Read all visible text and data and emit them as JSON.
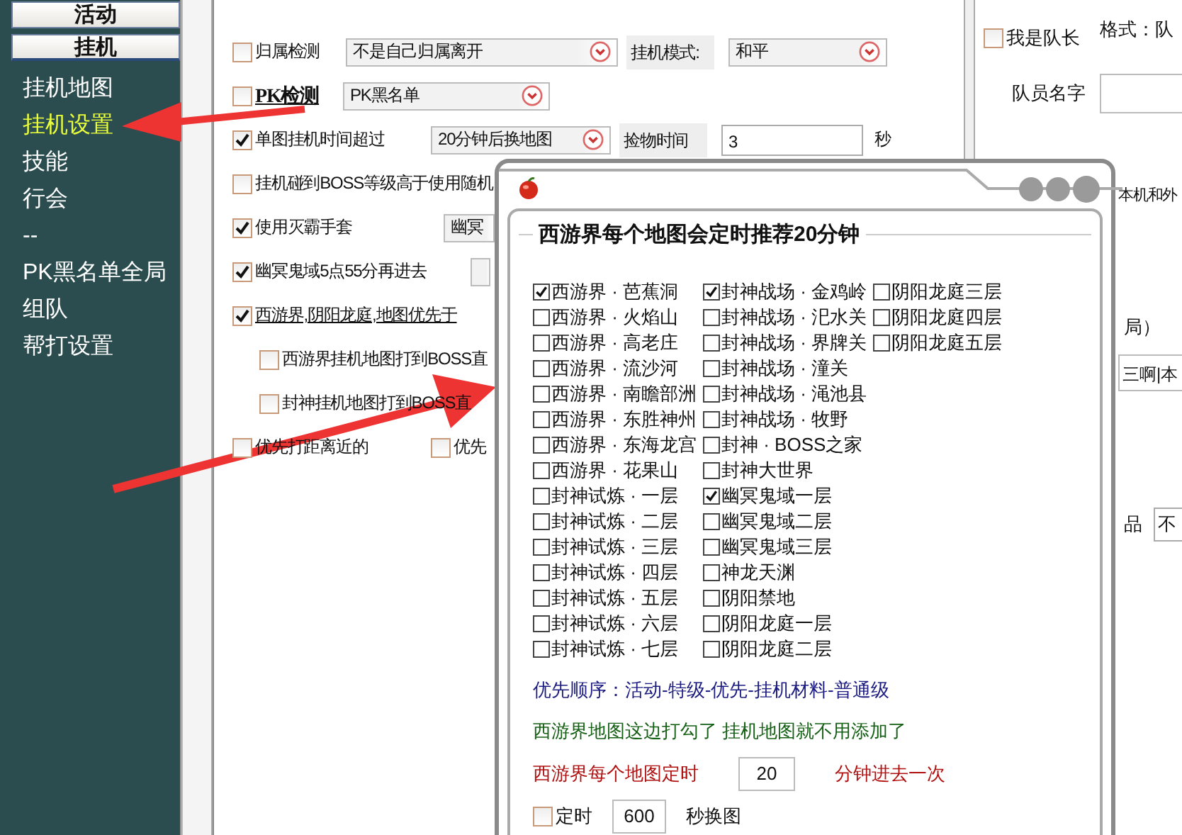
{
  "sidebar": {
    "tabs": [
      {
        "label": "活动",
        "selected": false
      },
      {
        "label": "挂机",
        "selected": true
      }
    ],
    "items": [
      {
        "label": "挂机地图",
        "selected": false
      },
      {
        "label": "挂机设置",
        "selected": true
      },
      {
        "label": "技能",
        "selected": false
      },
      {
        "label": "行会",
        "selected": false
      },
      {
        "label": "--",
        "selected": false
      },
      {
        "label": "PK黑名单全局",
        "selected": false
      },
      {
        "label": "组队",
        "selected": false
      },
      {
        "label": "帮打设置",
        "selected": false
      }
    ]
  },
  "settings": {
    "rows": [
      {
        "items": [
          {
            "kind": "checkbox",
            "label": "归属检测",
            "checked": false
          },
          {
            "kind": "select",
            "value": "不是自己归属离开"
          },
          {
            "kind": "label",
            "text": "挂机模式:"
          },
          {
            "kind": "select",
            "value": "和平"
          }
        ]
      },
      {
        "items": [
          {
            "kind": "link_checkbox",
            "label": "PK检测",
            "checked": false
          },
          {
            "kind": "select",
            "value": "PK黑名单"
          }
        ]
      },
      {
        "items": [
          {
            "kind": "checkbox",
            "label": "单图挂机时间超过",
            "checked": true
          },
          {
            "kind": "select",
            "value": "20分钟后换地图"
          },
          {
            "kind": "label",
            "text": "捡物时间"
          },
          {
            "kind": "input",
            "value": "3"
          },
          {
            "kind": "text",
            "text": "秒"
          }
        ]
      },
      {
        "items": [
          {
            "kind": "checkbox",
            "label": "挂机碰到BOSS等级高于使用随机",
            "checked": false
          }
        ]
      },
      {
        "items": [
          {
            "kind": "checkbox",
            "label": "使用灭霸手套",
            "checked": true
          },
          {
            "kind": "select_cut",
            "value": "幽冥"
          }
        ]
      },
      {
        "items": [
          {
            "kind": "checkbox",
            "label": "幽冥鬼域5点55分再进去",
            "checked": true
          },
          {
            "kind": "select_edge"
          }
        ]
      },
      {
        "items": [
          {
            "kind": "underlined_checkbox",
            "label": "西游界,阴阳龙庭,地图优先于",
            "checked": true
          }
        ]
      },
      {
        "items": [
          {
            "kind": "sub_checkbox",
            "label": "西游界挂机地图打到BOSS直",
            "checked": false
          }
        ]
      },
      {
        "items": [
          {
            "kind": "sub_checkbox",
            "label": "封神挂机地图打到BOSS直",
            "checked": false
          }
        ]
      },
      {
        "items": [
          {
            "kind": "checkbox",
            "label": "优先打距离近的",
            "checked": false
          },
          {
            "kind": "checkbox",
            "label": "优先",
            "checked": false
          }
        ]
      }
    ]
  },
  "team": {
    "format_hint": "格式：队",
    "leader": {
      "label": "我是队长",
      "checked": false
    },
    "member_name_label": "队员名字",
    "fragment_1": "本机和外",
    "fragment_2": "局）",
    "names_field": "三啊|本",
    "fragment_3": "品",
    "drop_value": "不"
  },
  "dialog": {
    "group_title": "西游界每个地图会定时推荐20分钟",
    "columns": [
      {
        "items": [
          {
            "label": "西游界 · 芭蕉洞",
            "checked": true
          },
          {
            "label": "西游界 · 火焰山",
            "checked": false
          },
          {
            "label": "西游界 · 高老庄",
            "checked": false
          },
          {
            "label": "西游界 · 流沙河",
            "checked": false
          },
          {
            "label": "西游界 · 南瞻部洲",
            "checked": false
          },
          {
            "label": "西游界 · 东胜神州",
            "checked": false
          },
          {
            "label": "西游界 · 东海龙宫",
            "checked": false
          },
          {
            "label": "西游界 · 花果山",
            "checked": false
          },
          {
            "label": "封神试炼 · 一层",
            "checked": false
          },
          {
            "label": "封神试炼 · 二层",
            "checked": false
          },
          {
            "label": "封神试炼 · 三层",
            "checked": false
          },
          {
            "label": "封神试炼 · 四层",
            "checked": false
          },
          {
            "label": "封神试炼 · 五层",
            "checked": false
          },
          {
            "label": "封神试炼 · 六层",
            "checked": false
          },
          {
            "label": "封神试炼 · 七层",
            "checked": false
          }
        ]
      },
      {
        "items": [
          {
            "label": "封神战场 · 金鸡岭",
            "checked": true
          },
          {
            "label": "封神战场 · 汜水关",
            "checked": false
          },
          {
            "label": "封神战场 · 界牌关",
            "checked": false
          },
          {
            "label": "封神战场 · 潼关",
            "checked": false
          },
          {
            "label": "封神战场 · 渑池县",
            "checked": false
          },
          {
            "label": "封神战场 · 牧野",
            "checked": false
          },
          {
            "label": "封神 · BOSS之家",
            "checked": false
          },
          {
            "label": "封神大世界",
            "checked": false
          },
          {
            "label": "幽冥鬼域一层",
            "checked": true
          },
          {
            "label": "幽冥鬼域二层",
            "checked": false
          },
          {
            "label": "幽冥鬼域三层",
            "checked": false
          },
          {
            "label": "神龙天渊",
            "checked": false
          },
          {
            "label": "阴阳禁地",
            "checked": false
          },
          {
            "label": "阴阳龙庭一层",
            "checked": false
          },
          {
            "label": "阴阳龙庭二层",
            "checked": false
          }
        ]
      },
      {
        "items": [
          {
            "label": "阴阳龙庭三层",
            "checked": false
          },
          {
            "label": "阴阳龙庭四层",
            "checked": false
          },
          {
            "label": "阴阳龙庭五层",
            "checked": false
          }
        ]
      }
    ],
    "priority_note": "优先顺序：活动-特级-优先-挂机材料-普通级",
    "tip": "西游界地图这边打勾了 挂机地图就不用添加了",
    "interval": {
      "label": "西游界每个地图定时",
      "value": "20",
      "unit": "分钟进去一次"
    },
    "timer": {
      "label": "定时",
      "checked": false,
      "value": "600",
      "unit": "秒换图"
    }
  }
}
